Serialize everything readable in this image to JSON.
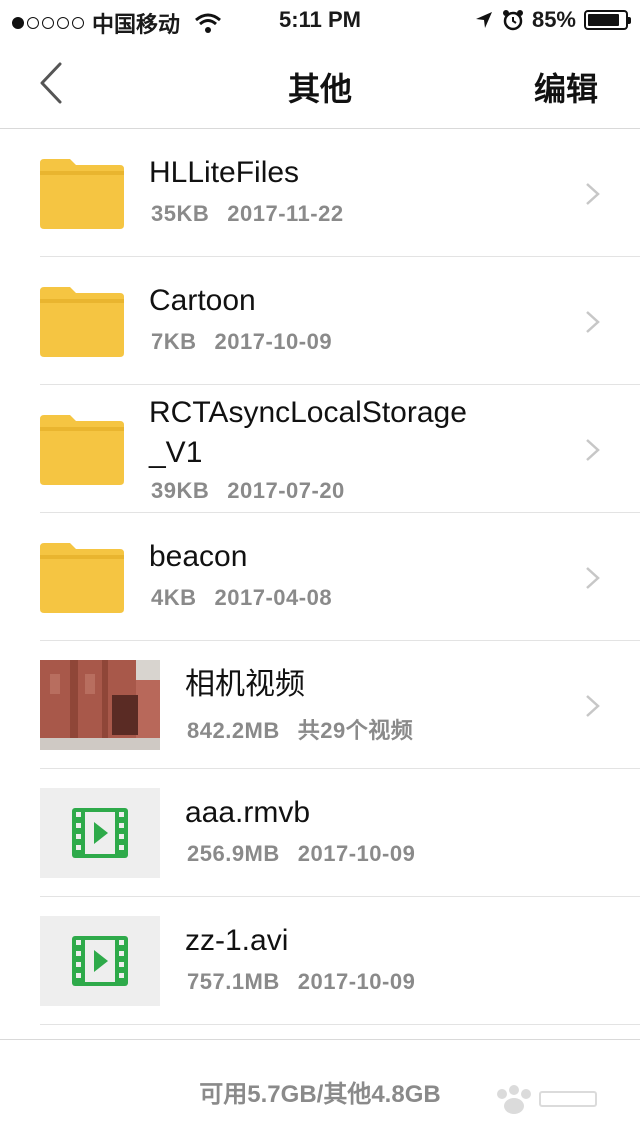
{
  "status_bar": {
    "carrier": "中国移动",
    "time": "5:11 PM",
    "battery_percent": "85%",
    "battery_level": 0.85,
    "signal_bars_filled": 1
  },
  "nav": {
    "title": "其他",
    "edit_label": "编辑",
    "back_icon": "chevron-left-icon"
  },
  "files": [
    {
      "type": "folder",
      "name": "HLLiteFiles",
      "size": "35KB",
      "date": "2017-11-22",
      "has_chevron": true
    },
    {
      "type": "folder",
      "name": "Cartoon",
      "size": "7KB",
      "date": "2017-10-09",
      "has_chevron": true
    },
    {
      "type": "folder",
      "name_line1": "RCTAsyncLocalStorage",
      "name_line2": "_V1",
      "size": "39KB",
      "date": "2017-07-20",
      "has_chevron": true
    },
    {
      "type": "folder",
      "name": "beacon",
      "size": "4KB",
      "date": "2017-04-08",
      "has_chevron": true
    },
    {
      "type": "album",
      "name": "相机视频",
      "size": "842.2MB",
      "count": "共29个视频",
      "has_chevron": true
    },
    {
      "type": "video",
      "name": "aaa.rmvb",
      "size": "256.9MB",
      "date": "2017-10-09"
    },
    {
      "type": "video",
      "name": "zz-1.avi",
      "size": "757.1MB",
      "date": "2017-10-09"
    }
  ],
  "footer": {
    "storage_text": "可用5.7GB/其他4.8GB"
  },
  "colors": {
    "folder": "#f5c542",
    "video_icon": "#2eaa4a",
    "text_secondary": "#8a8a8a"
  }
}
